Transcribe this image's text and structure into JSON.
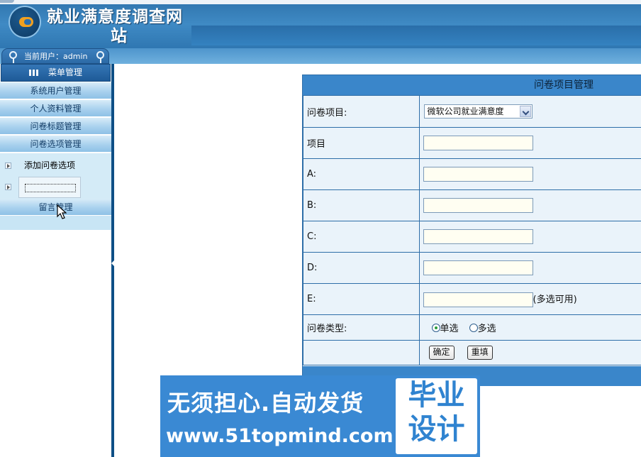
{
  "header": {
    "title": "就业满意度调查网",
    "title_line2": "站",
    "current_user": "当前用户：admin"
  },
  "sidebar": {
    "menu_title": "菜单管理",
    "items": [
      {
        "label": "系统用户管理"
      },
      {
        "label": "个人资料管理"
      },
      {
        "label": "问卷标题管理"
      },
      {
        "label": "问卷选项管理"
      }
    ],
    "sub_items": [
      {
        "label": "添加问卷选项"
      }
    ],
    "message_item": "留言管理"
  },
  "form": {
    "title": "问卷项目管理",
    "rows": {
      "project_label": "问卷项目:",
      "project_selected": "微软公司就业满意度",
      "item_label": "项目",
      "a_label": "A:",
      "b_label": "B:",
      "c_label": "C:",
      "d_label": "D:",
      "e_label": "E:",
      "e_hint": "(多选可用)",
      "type_label": "问卷类型:",
      "type_single": "单选",
      "type_multi": "多选"
    },
    "buttons": {
      "confirm": "确定",
      "reset": "重填"
    },
    "selected_type": "单选"
  },
  "banner": {
    "line1": "无须担心.自动发货",
    "line2": "www.51topmind.com",
    "badge_line1": "毕业",
    "badge_line2": "设计"
  },
  "colors": {
    "header_blue": "#2f74ad",
    "sidebar_rule": "#0e4f86",
    "form_border": "#2e6ea8",
    "form_title_bg": "#3a86ca",
    "banner_bg": "#3a89d3"
  }
}
